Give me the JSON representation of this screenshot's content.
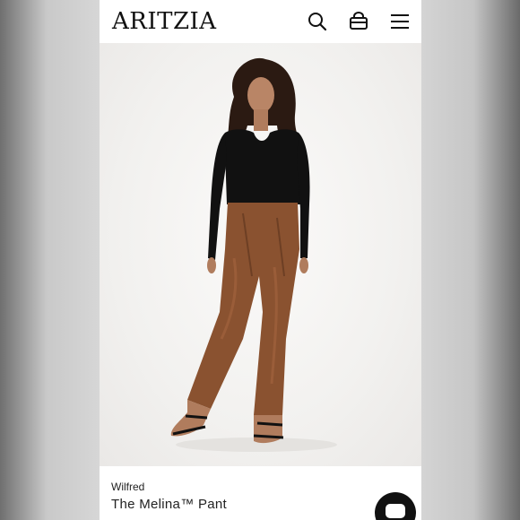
{
  "header": {
    "logo": "ARITZIA",
    "icons": [
      "search-icon",
      "shopping-bag-icon",
      "hamburger-menu-icon"
    ]
  },
  "product": {
    "brand": "Wilfred",
    "name": "The Melina™ Pant",
    "image": "model-wearing-brown-faux-leather-pants"
  },
  "chat": {
    "icon": "chat-icon"
  },
  "colors": {
    "background": "#d4d4d4",
    "header": "#ffffff",
    "text": "#111111",
    "pants": "#8a5230",
    "top": "#111111"
  }
}
